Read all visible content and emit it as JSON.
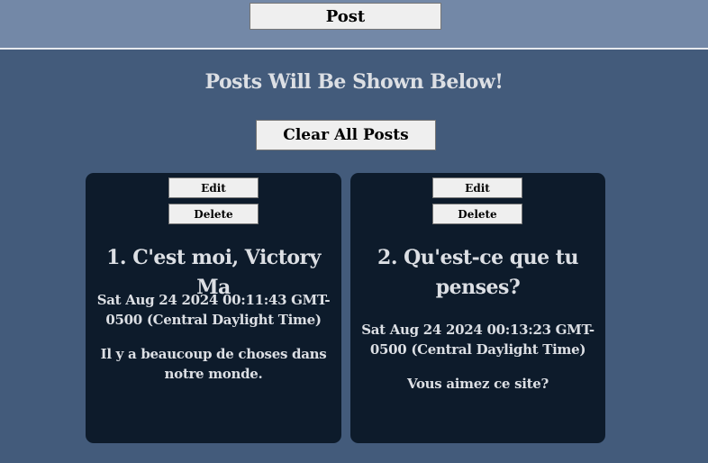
{
  "header": {
    "post_label": "Post"
  },
  "main": {
    "heading": "Posts Will Be Shown Below!",
    "clear_label": "Clear All Posts"
  },
  "posts": [
    {
      "edit_label": "Edit",
      "delete_label": "Delete",
      "title": "1. C'est moi, Victory Ma",
      "date": "Sat Aug 24 2024 00:11:43 GMT-0500 (Central Daylight Time)",
      "body": "Il y a beaucoup de choses dans notre monde."
    },
    {
      "edit_label": "Edit",
      "delete_label": "Delete",
      "title": "2. Qu'est-ce que tu penses?",
      "date": "Sat Aug 24 2024 00:13:23 GMT-0500 (Central Daylight Time)",
      "body": "Vous aimez ce site?"
    }
  ],
  "colors": {
    "page_background": "#435b7b",
    "topbar_background": "#7388a7",
    "card_background": "#0d1b2b",
    "text_light": "#dcdfe4"
  }
}
